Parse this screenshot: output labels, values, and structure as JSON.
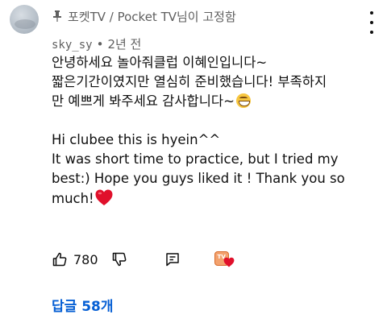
{
  "comment": {
    "pinned_label": "포켓TV / Pocket TV님이 고정함",
    "username": "sky_sy",
    "separator": "•",
    "timestamp": "2년 전",
    "lines_ko": [
      "안녕하세요 놀아줘클럽 이혜인입니다~",
      "짧은기간이였지만 열심히 준비했습니다! 부족하지",
      "만 예쁘게 봐주세요 감사합니다~"
    ],
    "lines_en": [
      "Hi clubee this is hyein^^",
      "It was short time to practice, but I tried my",
      "best:) Hope you guys liked it ! Thank you so",
      "much!"
    ],
    "like_count": "780",
    "creator_avatar_text": "TV",
    "replies_label": "답글 58개"
  },
  "icons": {
    "pin": "pin-icon",
    "more": "more-vert-icon",
    "like": "thumbs-up-icon",
    "dislike": "thumbs-down-icon",
    "reply": "reply-icon",
    "creator_heart": "creator-heart-icon",
    "grin": "grinning-emoji",
    "heart": "red-heart-emoji"
  },
  "colors": {
    "secondary_text": "#606060",
    "primary_text": "#0f0f0f",
    "link": "#065fd4",
    "heart": "#e0102b"
  }
}
